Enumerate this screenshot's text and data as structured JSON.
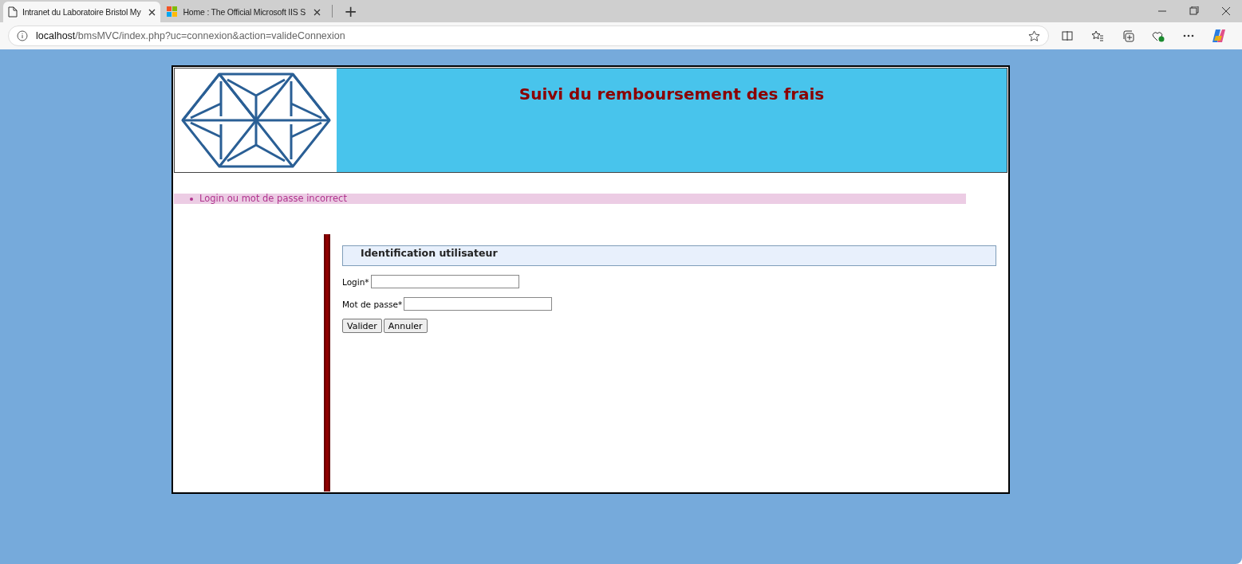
{
  "browser": {
    "tabs": [
      {
        "title": "Intranet du Laboratoire Bristol My",
        "selected": true
      },
      {
        "title": "Home : The Official Microsoft IIS S",
        "selected": false
      }
    ],
    "new_tab": "+",
    "address": {
      "host": "localhost",
      "path": "/bmsMVC/index.php?uc=connexion&action=valideConnexion"
    }
  },
  "header": {
    "title": "Suivi du remboursement des frais"
  },
  "errors": [
    "Login ou mot de passe incorrect"
  ],
  "form": {
    "legend": "Identification utilisateur",
    "fields": [
      {
        "label": "Login*"
      },
      {
        "label": "Mot de passe*"
      }
    ],
    "buttons": [
      "Valider",
      "Annuler"
    ]
  }
}
